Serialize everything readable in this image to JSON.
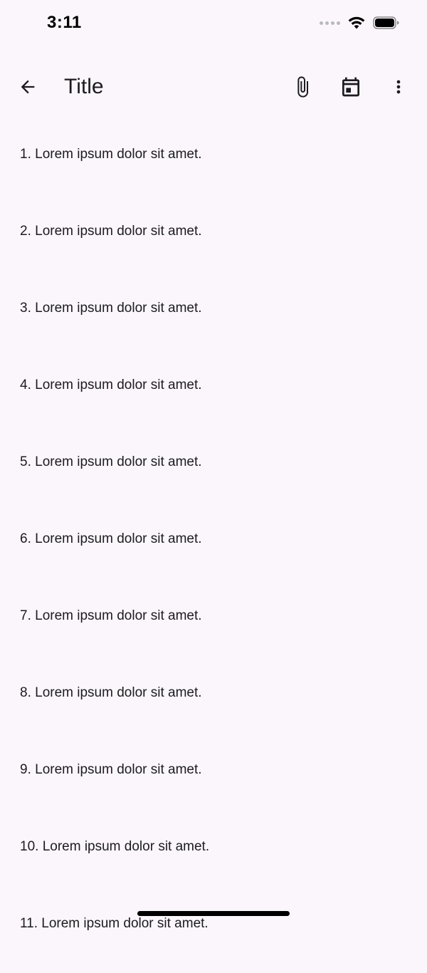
{
  "status_bar": {
    "time": "3:11"
  },
  "app_bar": {
    "title": "Title",
    "icons": [
      "arrow-back-icon",
      "attach-icon",
      "calendar-icon",
      "more-vert-icon"
    ]
  },
  "items": [
    "1. Lorem ipsum dolor sit amet.",
    "2. Lorem ipsum dolor sit amet.",
    "3. Lorem ipsum dolor sit amet.",
    "4. Lorem ipsum dolor sit amet.",
    "5. Lorem ipsum dolor sit amet.",
    "6. Lorem ipsum dolor sit amet.",
    "7. Lorem ipsum dolor sit amet.",
    "8. Lorem ipsum dolor sit amet.",
    "9. Lorem ipsum dolor sit amet.",
    "10. Lorem ipsum dolor sit amet.",
    "11. Lorem ipsum dolor sit amet."
  ],
  "colors": {
    "background": "#fbf6fb",
    "text": "#1c1b1f"
  }
}
